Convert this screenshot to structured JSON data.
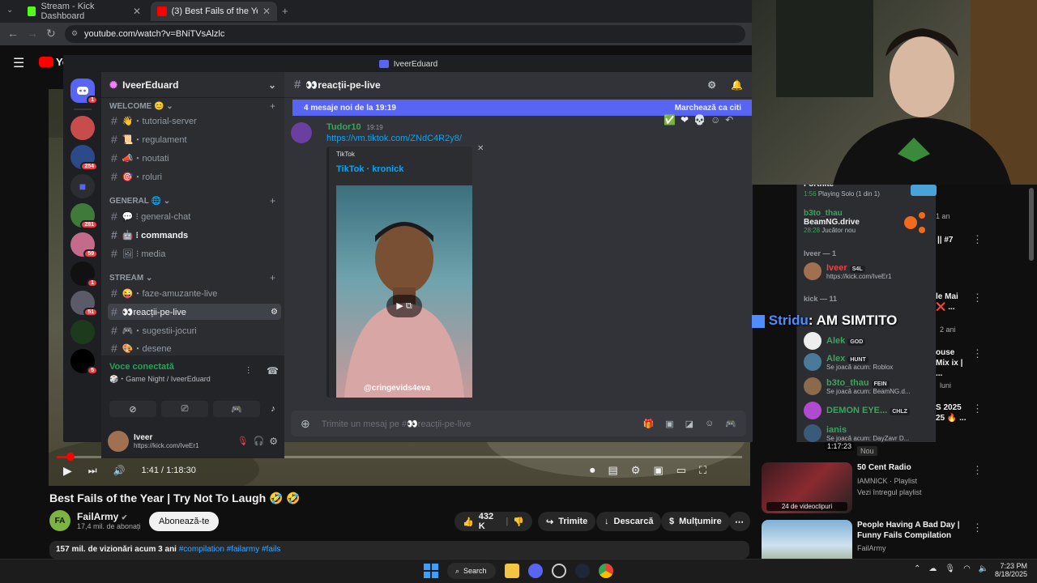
{
  "browser": {
    "tabs": [
      {
        "label": "Stream - Kick Dashboard"
      },
      {
        "label": "(3) Best Fails of the Year | Try No"
      }
    ],
    "url": "youtube.com/watch?v=BNiTVsAlzlc"
  },
  "youtube": {
    "logo": "Yo",
    "video_title": "Best Fails of the Year | Try Not To Laugh 🤣 🤣",
    "time": "1:41 / 1:18:30",
    "channel_name": "FailArmy",
    "subscribers": "17,4 mil. de abonați",
    "subscribe_label": "Abonează-te",
    "likes": "432 K",
    "share_label": "Trimite",
    "download_label": "Descarcă",
    "thanks_label": "Mulțumire",
    "views": "157 mil. de vizionări  acum 3 ani",
    "hashtags": "#compilation #failarmy #fails"
  },
  "discord": {
    "window_title": "IveerEduard",
    "server_name": "IveerEduard",
    "server_badges": [
      "1",
      "254",
      "281",
      "59",
      "1",
      "51",
      "5"
    ],
    "categories": {
      "welcome": "WELCOME 😊",
      "general": "GENERAL 🌐",
      "stream": "STREAM"
    },
    "channels_welcome": [
      "👋・tutorial-server",
      "📜・regulament",
      "📣・noutati",
      "🎯・roluri"
    ],
    "channels_general": [
      "💬 ⁝ general-chat",
      "🤖 ⁝ commands",
      "🖼 ⁝ media"
    ],
    "channels_stream": [
      "😜・faze-amuzante-live",
      "👀reacții-pe-live",
      "🎮・sugestii-jocuri",
      "🎨・desene"
    ],
    "voice_status": "Voce conectată",
    "voice_channel": "🎲・Game Night / IveerEduard",
    "user_name": "Iveer",
    "user_status": "https://kick.com/IveEr1",
    "chat_channel": "👀reacții-pe-live",
    "new_messages": "4 mesaje noi de la 19:19",
    "mark_read": "Marchează ca citi",
    "author": "Tudor10",
    "timestamp": "19:19",
    "link": "https://vm.tiktok.com/ZNdC4R2y8/",
    "embed_provider": "TikTok",
    "embed_title": "TikTok · kronick",
    "tiktok_watermark": "@cringevids4eva",
    "input_placeholder": "Trimite un mesaj pe #👀reacții-pe-live"
  },
  "members": {
    "top": {
      "game_line": "Fortnite",
      "game_time": "1:56",
      "game_status": "Playing Solo (1 din 1)"
    },
    "b3to": {
      "name": "b3to_thau",
      "game": "BeamNG.drive",
      "time": "28:28",
      "status": "Jucător nou"
    },
    "iveer_header": "Iveer — 1",
    "iveer_member": {
      "name": "Iveer",
      "tag": "S4L",
      "status": "https://kick.com/IveEr1"
    },
    "kick_header": "kick — 11",
    "list": [
      {
        "name": "Alek",
        "tag": "GOD",
        "status": "",
        "color": "#3ba55c"
      },
      {
        "name": "Alex",
        "tag": "HUNT",
        "status": "Se joacă acum: Roblox",
        "color": "#3ba55c"
      },
      {
        "name": "b3to_thau",
        "tag": "FEIN",
        "status": "Se joacă acum: BeamNG.d...",
        "color": "#3ba55c"
      },
      {
        "name": "DEMON EYE...",
        "tag": "CHLZ",
        "status": "",
        "color": "#3ba55c"
      },
      {
        "name": "ianis",
        "tag": "",
        "status": "Se joacă acum: DayZavr D...",
        "color": "#3ba55c"
      }
    ]
  },
  "overlay": {
    "name": "Stridu",
    "message": ": AM SIMTITO"
  },
  "recommendations": [
    {
      "title": "",
      "sub1": "1 an",
      "sub2": ""
    },
    {
      "title": "|| #7",
      "sub1": "",
      "sub2": ""
    },
    {
      "title": "le Mai ❌ ...",
      "sub1": "2 ani",
      "sub2": ""
    },
    {
      "title": "ouse Mix ix | ...",
      "sub1": "luni",
      "sub2": ""
    },
    {
      "title": "S 2025 25 🔥 ...",
      "sub1": "",
      "sub2": ""
    },
    {
      "title": "",
      "sub1": "1:17:23",
      "sub2": "Nou"
    },
    {
      "title": "50 Cent Radio",
      "sub1": "IAMNICK · Playlist",
      "sub2": "Vezi întregul playlist",
      "badge": "24 de videoclipuri"
    },
    {
      "title": "People Having A Bad Day | Funny Fails Compilation",
      "sub1": "FailArmy",
      "sub2": ""
    }
  ],
  "taskbar": {
    "search_label": "Search",
    "time": "7:23 PM",
    "date": "8/18/2025"
  },
  "icons": [
    "menu-icon",
    "back-icon",
    "forward-icon",
    "reload-icon",
    "play-icon",
    "next-icon",
    "volume-icon",
    "settings-icon",
    "fullscreen-icon",
    "like-icon",
    "share-icon",
    "download-icon",
    "hash-icon",
    "bell-icon",
    "plus-icon",
    "gift-icon",
    "emoji-icon",
    "mic-icon",
    "headphones-icon",
    "gear-icon",
    "windows-icon",
    "search-icon",
    "folder-icon",
    "chrome-icon",
    "steam-icon"
  ]
}
